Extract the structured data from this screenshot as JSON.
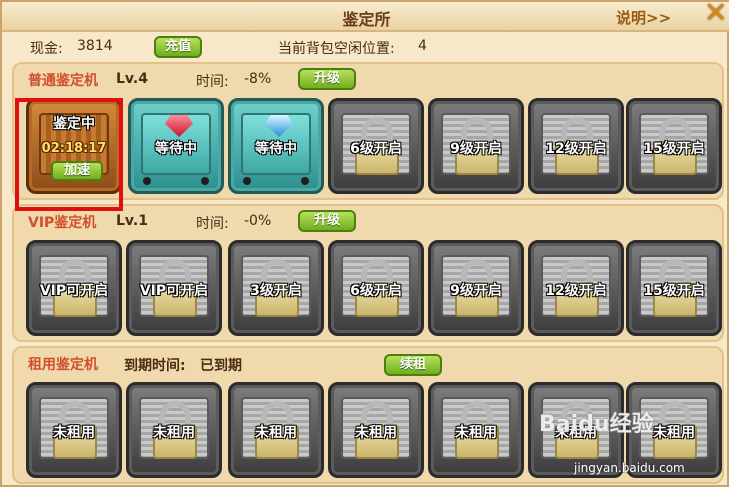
{
  "window": {
    "title": "鉴定所",
    "help_label": "说明>>",
    "close_label": "✕"
  },
  "info": {
    "money_label": "现金:",
    "money_value": "3814",
    "recharge_label": "充值",
    "bag_label": "当前背包空闲位置:",
    "bag_value": "4"
  },
  "normal": {
    "name": "普通鉴定机",
    "level": "Lv.4",
    "time_label": "时间:",
    "time_value": "-8%",
    "upgrade_label": "升级",
    "slots": [
      {
        "state": "identifying",
        "title": "鉴定中",
        "timer": "02:18:17",
        "button": "加速"
      },
      {
        "state": "waiting",
        "label": "等待中",
        "gem": "red-gem"
      },
      {
        "state": "waiting",
        "label": "等待中",
        "gem": "blue-gem"
      },
      {
        "state": "locked",
        "label": "6级开启"
      },
      {
        "state": "locked",
        "label": "9级开启"
      },
      {
        "state": "locked",
        "label": "12级开启"
      },
      {
        "state": "locked",
        "label": "15级开启"
      }
    ]
  },
  "vip": {
    "name": "VIP鉴定机",
    "level": "Lv.1",
    "time_label": "时间:",
    "time_value": "-0%",
    "upgrade_label": "升级",
    "slots": [
      {
        "label": "VIP可开启"
      },
      {
        "label": "VIP可开启"
      },
      {
        "label": "3级开启"
      },
      {
        "label": "6级开启"
      },
      {
        "label": "9级开启"
      },
      {
        "label": "12级开启"
      },
      {
        "label": "15级开启"
      }
    ]
  },
  "rent": {
    "name": "租用鉴定机",
    "expire_label": "到期时间:",
    "expire_value": "已到期",
    "renew_label": "续租",
    "slots": [
      {
        "label": "未租用"
      },
      {
        "label": "未租用"
      },
      {
        "label": "未租用"
      },
      {
        "label": "未租用"
      },
      {
        "label": "未租用"
      },
      {
        "label": "未租用"
      },
      {
        "label": "未租用"
      }
    ]
  },
  "watermark": {
    "logo": "Baidu经验",
    "url": "jingyan.baidu.com"
  },
  "colors": {
    "highlight": "#e01010",
    "button_green": "#6fae1e",
    "section_title": "#d24f2b"
  }
}
